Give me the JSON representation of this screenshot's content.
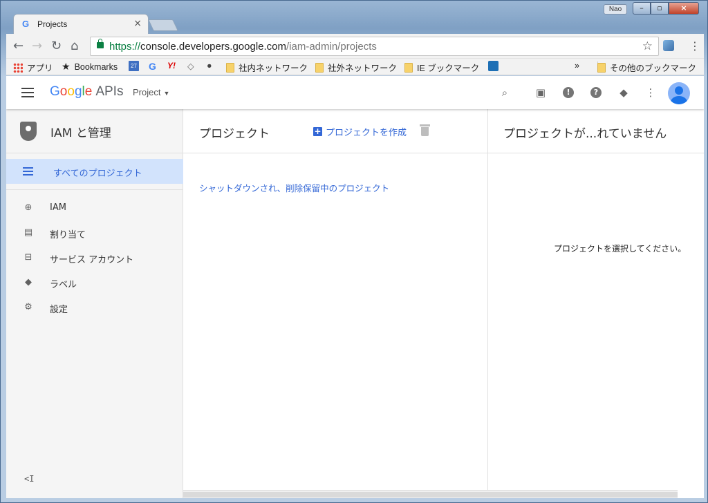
{
  "browser": {
    "tab_title": "Projects",
    "tab_favicon": "G",
    "tab_close": "×",
    "user_badge": "Nao",
    "url_scheme": "https://",
    "url_host": "console.developers.google.com",
    "url_path": "/iam-admin/projects",
    "back_icon": "←",
    "forward_icon": "→",
    "reload_icon": "↻",
    "home_icon": "⌂",
    "star_icon": "☆",
    "menu_icon": "⋮"
  },
  "bookmarks": {
    "apps": "アプリ",
    "bookmarks": "Bookmarks",
    "calendar_day": "27",
    "google": "G",
    "yahoo": "Y!",
    "internal": "社内ネットワーク",
    "external": "社外ネットワーク",
    "ie": "IE ブックマーク",
    "overflow": "»",
    "other": "その他のブックマーク"
  },
  "appbar": {
    "logo": [
      "G",
      "o",
      "o",
      "g",
      "l",
      "e"
    ],
    "apis": "APIs",
    "project_label": "Project",
    "caret": "▼"
  },
  "sidebar": {
    "title": "IAM と管理",
    "active_item": "すべてのプロジェクト",
    "items": [
      {
        "label": "IAM",
        "icon": "person-add-icon"
      },
      {
        "label": "割り当て",
        "icon": "quota-icon"
      },
      {
        "label": "サービス アカウント",
        "icon": "service-account-icon"
      },
      {
        "label": "ラベル",
        "icon": "label-icon"
      },
      {
        "label": "設定",
        "icon": "gear-icon"
      }
    ],
    "collapse": "<I"
  },
  "projects_panel": {
    "title": "プロジェクト",
    "create_label": "プロジェクトを作成",
    "shutdown_link": "シャットダウンされ、削除保留中のプロジェクト"
  },
  "details_panel": {
    "title": "プロジェクトが...れていません",
    "message": "プロジェクトを選択してください。"
  },
  "colors": {
    "accent": "#3367d6",
    "active_bg": "#d2e3fc"
  }
}
